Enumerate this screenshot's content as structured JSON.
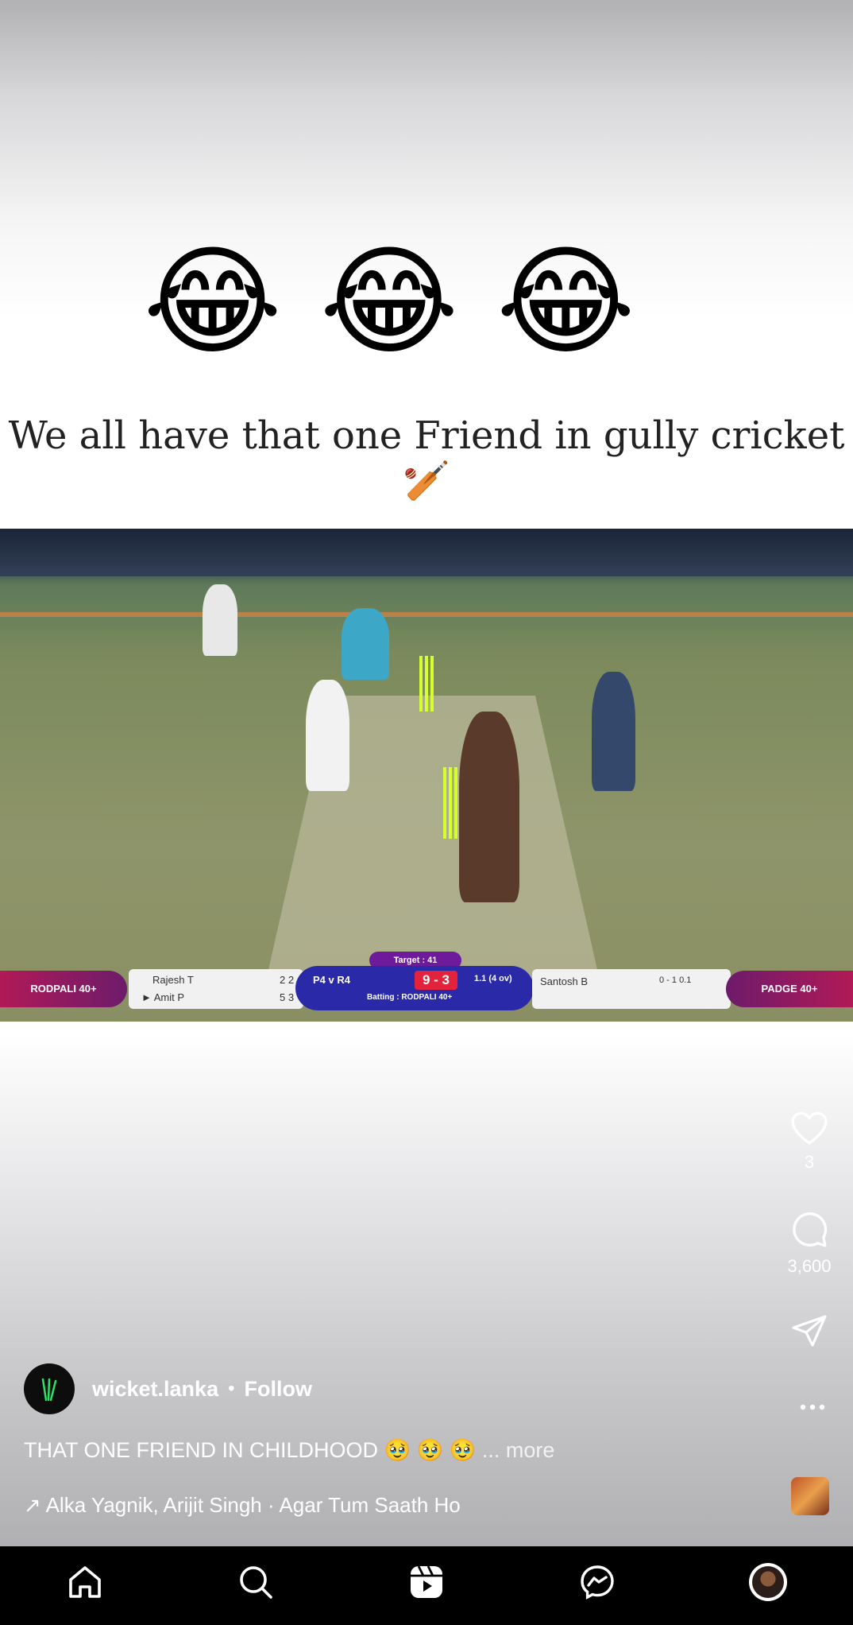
{
  "post": {
    "emojis": [
      "😂",
      "😂",
      "😂"
    ],
    "headline": "We all have that one Friend in gully cricket 🏏"
  },
  "video": {
    "scoreboard": {
      "target": "Target : 41",
      "team_left": "RODPALI 40+",
      "batsman1": "Rajesh T",
      "batsman1_stats": "2 2",
      "batsman2": "► Amit P",
      "batsman2_stats": "5 3",
      "match": "P4 v R4",
      "score": "9 - 3",
      "overs": "1.1 (4 ov)",
      "batting": "Batting : RODPALI 40+",
      "bowler": "Santosh B",
      "bowler_stats": "0 - 1 0.1",
      "team_right": "PADGE 40+"
    }
  },
  "actions": {
    "likes": "3",
    "comments": "3,600"
  },
  "author": {
    "handle": "wicket.lanka",
    "separator": "•",
    "follow": "Follow"
  },
  "caption": {
    "text": "THAT ONE FRIEND IN CHILDHOOD 🥹 🥹 🥹",
    "more": "... more"
  },
  "music": {
    "text": "↗ Alka Yagnik, Arijit Singh · Agar Tum Saath Ho"
  },
  "nav": {
    "items": [
      "home-icon",
      "search-icon",
      "reels-icon",
      "messenger-icon",
      "profile-avatar"
    ]
  }
}
